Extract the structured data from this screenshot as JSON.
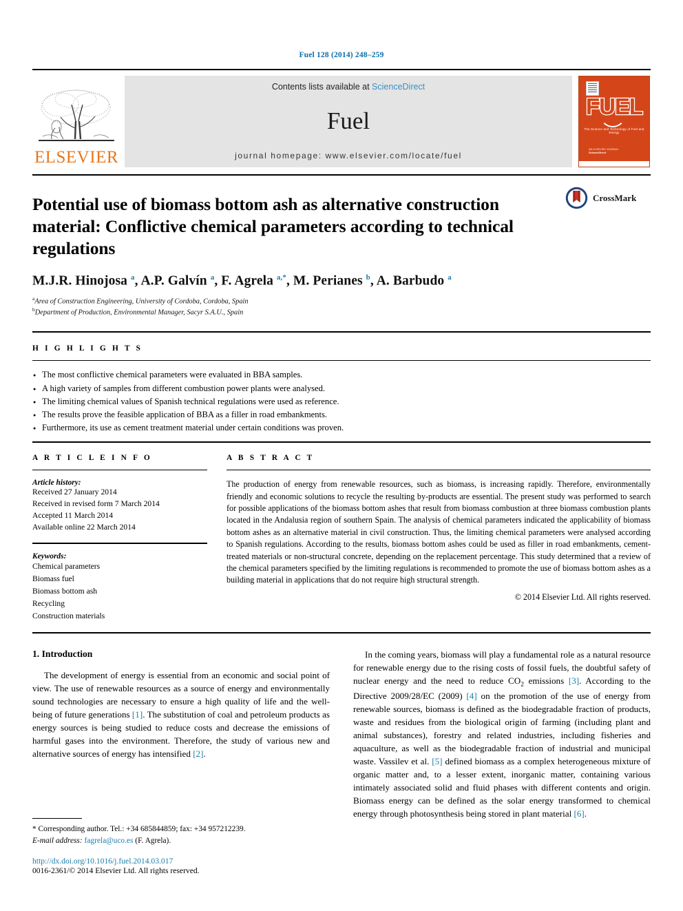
{
  "running_head": "Fuel 128 (2014) 248–259",
  "masthead": {
    "publisher_name": "ELSEVIER",
    "contents_prefix": "Contents lists available at",
    "sciencedirect": "ScienceDirect",
    "journal_title": "Fuel",
    "homepage": "journal homepage: www.elsevier.com/locate/fuel",
    "cover": {
      "title": "FUEL",
      "subtitle": "The Science and Technology of Fuel and Energy",
      "footer_line1": "AN ELSEVIER JOURNAL",
      "footer_line2": "ScienceDirect"
    }
  },
  "article": {
    "title": "Potential use of biomass bottom ash as alternative construction material: Conflictive chemical parameters according to technical regulations",
    "crossmark_label": "CrossMark",
    "authors_html": "M.J.R. Hinojosa <sup>a</sup>, A.P. Galvín <sup>a</sup>, F. Agrela <sup>a,*</sup>, M. Perianes <sup>b</sup>, A. Barbudo <sup>a</sup>",
    "affiliations": [
      {
        "marker": "a",
        "text": "Area of Construction Engineering, University of Cordoba, Cordoba, Spain"
      },
      {
        "marker": "b",
        "text": "Department of Production, Environmental Manager, Sacyr S.A.U., Spain"
      }
    ]
  },
  "highlights": {
    "label": "H I G H L I G H T S",
    "items": [
      "The most conflictive chemical parameters were evaluated in BBA samples.",
      "A high variety of samples from different combustion power plants were analysed.",
      "The limiting chemical values of Spanish technical regulations were used as reference.",
      "The results prove the feasible application of BBA as a filler in road embankments.",
      "Furthermore, its use as cement treatment material under certain conditions was proven."
    ]
  },
  "article_info": {
    "label": "A R T I C L E   I N F O",
    "history_label": "Article history:",
    "history": [
      "Received 27 January 2014",
      "Received in revised form 7 March 2014",
      "Accepted 11 March 2014",
      "Available online 22 March 2014"
    ],
    "keywords_label": "Keywords:",
    "keywords": [
      "Chemical parameters",
      "Biomass fuel",
      "Biomass bottom ash",
      "Recycling",
      "Construction materials"
    ]
  },
  "abstract": {
    "label": "A B S T R A C T",
    "text": "The production of energy from renewable resources, such as biomass, is increasing rapidly. Therefore, environmentally friendly and economic solutions to recycle the resulting by-products are essential. The present study was performed to search for possible applications of the biomass bottom ashes that result from biomass combustion at three biomass combustion plants located in the Andalusia region of southern Spain. The analysis of chemical parameters indicated the applicability of biomass bottom ashes as an alternative material in civil construction. Thus, the limiting chemical parameters were analysed according to Spanish regulations. According to the results, biomass bottom ashes could be used as filler in road embankments, cement-treated materials or non-structural concrete, depending on the replacement percentage. This study determined that a review of the chemical parameters specified by the limiting regulations is recommended to promote the use of biomass bottom ashes as a building material in applications that do not require high structural strength.",
    "copyright": "© 2014 Elsevier Ltd. All rights reserved."
  },
  "body": {
    "section_heading": "1. Introduction",
    "left_paragraph_html": "The development of energy is essential from an economic and social point of view. The use of renewable resources as a source of energy and environmentally sound technologies are necessary to ensure a high quality of life and the well-being of future generations <span class=\"cite\">[1]</span>. The substitution of coal and petroleum products as energy sources is being studied to reduce costs and decrease the emissions of harmful gases into the environment. Therefore, the study of various new and alternative sources of energy has intensified <span class=\"cite\">[2]</span>.",
    "right_paragraph_html": "In the coming years, biomass will play a fundamental role as a natural resource for renewable energy due to the rising costs of fossil fuels, the doubtful safety of nuclear energy and the need to reduce CO<sub>2</sub> emissions <span class=\"cite\">[3]</span>. According to the Directive 2009/28/EC (2009) <span class=\"cite\">[4]</span> on the promotion of the use of energy from renewable sources, biomass is defined as the biodegradable fraction of products, waste and residues from the biological origin of farming (including plant and animal substances), forestry and related industries, including fisheries and aquaculture, as well as the biodegradable fraction of industrial and municipal waste. Vassilev et al. <span class=\"cite\">[5]</span> defined biomass as a complex heterogeneous mixture of organic matter and, to a lesser extent, inorganic matter, containing various intimately associated solid and fluid phases with different contents and origin. Biomass energy can be defined as the solar energy transformed to chemical energy through photosynthesis being stored in plant material <span class=\"cite\">[6]</span>."
  },
  "footer": {
    "corresponding_html": "* Corresponding author. Tel.: +34 685844859; fax: +34 957212239.",
    "email_label": "E-mail address:",
    "email": "fagrela@uco.es",
    "email_suffix": "(F. Agrela).",
    "doi": "http://dx.doi.org/10.1016/j.fuel.2014.03.017",
    "issn_line": "0016-2361/© 2014 Elsevier Ltd. All rights reserved."
  },
  "colors": {
    "link": "#1b7ca8",
    "elsevier_orange": "#e8761b",
    "cover_orange": "#d4461a",
    "banner_gray": "#e4e4e4"
  }
}
